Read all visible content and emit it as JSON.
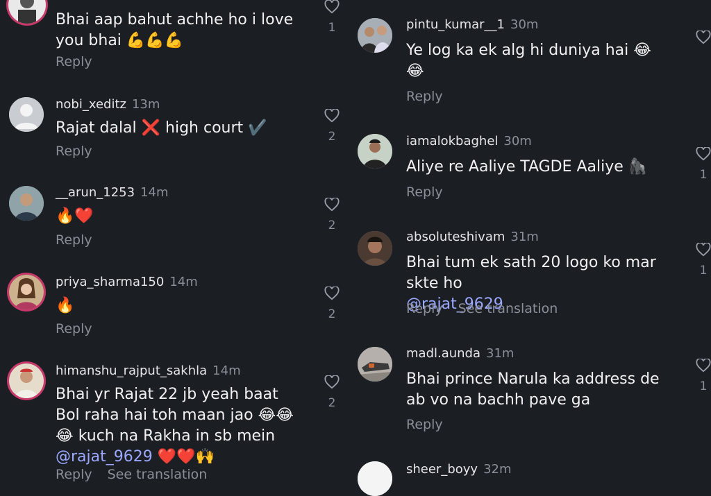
{
  "left": [
    {
      "username": "",
      "time": "",
      "text": "Bhai aap bahut achhe ho i love you bhai 💪💪💪",
      "reply": "Reply",
      "translate": "",
      "likes": "1",
      "ring": false
    },
    {
      "username": "nobi_xeditz",
      "time": "13m",
      "text": "Rajat dalal ❌ high court ✔️",
      "reply": "Reply",
      "translate": "",
      "likes": "2",
      "ring": false
    },
    {
      "username": "__arun_1253",
      "time": "14m",
      "text": "🔥❤️",
      "reply": "Reply",
      "translate": "",
      "likes": "2",
      "ring": false
    },
    {
      "username": "priya_sharma150",
      "time": "14m",
      "text": "🔥",
      "reply": "Reply",
      "translate": "",
      "likes": "2",
      "ring": true
    },
    {
      "username": "himanshu_rajput_sakhla",
      "time": "14m",
      "text": "Bhai yr Rajat 22 jb yeah baat Bol raha hai toh maan jao 😂😂😂 kuch na Rakha in sb mein",
      "mention": "@rajat_9629",
      "text_after": " ❤️❤️🙌",
      "reply": "Reply",
      "translate": "See translation",
      "likes": "2",
      "ring": true
    }
  ],
  "right": [
    {
      "username": "pintu_kumar__1",
      "time": "30m",
      "text": "Ye log ka ek  alg hi duniya hai 😂 😂",
      "reply": "Reply",
      "translate": "",
      "likes": ""
    },
    {
      "username": "iamalokbaghel",
      "time": "30m",
      "text": "Aliye re Aaliye TAGDE Aaliye 🦍",
      "reply": "Reply",
      "translate": "",
      "likes": "1"
    },
    {
      "username": "absoluteshivam",
      "time": "31m",
      "text": "Bhai tum ek sath 20 logo ko mar skte ho",
      "mention": "@rajat_9629",
      "reply": "Reply",
      "translate": "See translation",
      "likes": "1"
    },
    {
      "username": "madl.aunda",
      "time": "31m",
      "text": "Bhai prince Narula ka address de ab vo na bachh pave ga",
      "reply": "Reply",
      "translate": "",
      "likes": "1"
    },
    {
      "username": "sheer_boyy",
      "time": "32m",
      "text": "",
      "reply": "",
      "translate": "",
      "likes": ""
    }
  ]
}
